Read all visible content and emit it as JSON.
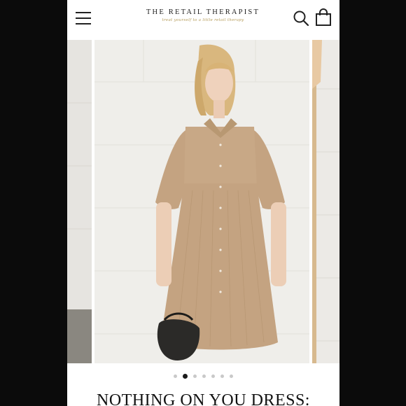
{
  "header": {
    "menu_icon": "hamburger-menu-icon",
    "brand_name": "THE RETAIL THERAPIST",
    "brand_tagline": "treat yourself to a little retail therapy",
    "search_icon": "search-icon",
    "cart_icon": "shopping-bag-icon"
  },
  "gallery": {
    "slide_count": 7,
    "active_index": 1,
    "product_color": "#c4a381"
  },
  "product": {
    "title": "NOTHING ON YOU DRESS:"
  },
  "colors": {
    "background": "#0b0b0b",
    "page": "#ffffff",
    "dot_active": "#1a1a1a",
    "dot_inactive": "#c9c9c9",
    "tagline_gold": "#b49a57"
  }
}
